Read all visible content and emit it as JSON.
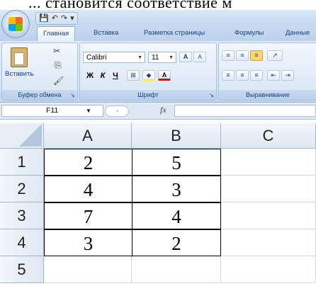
{
  "top_text": "... становится соответствие м",
  "quick_access": {
    "save_icon": "save-icon",
    "undo_icon": "undo-icon",
    "redo_icon": "redo-icon",
    "more": "▾"
  },
  "tabs": [
    {
      "label": "Главная",
      "active": true
    },
    {
      "label": "Вставка"
    },
    {
      "label": "Разметка страницы"
    },
    {
      "label": "Формулы"
    },
    {
      "label": "Данные"
    }
  ],
  "ribbon": {
    "clipboard": {
      "paste_label": "Вставить",
      "group_label": "Буфер обмена"
    },
    "font": {
      "font_name": "Calibri",
      "font_size": "11",
      "grow": "A",
      "shrink": "A",
      "bold": "Ж",
      "italic": "К",
      "underline": "Ч",
      "group_label": "Шрифт"
    },
    "alignment": {
      "group_label": "Выравнивание"
    }
  },
  "formula_bar": {
    "name_box": "F11",
    "fx": "fx",
    "formula": ""
  },
  "sheet": {
    "columns": [
      "A",
      "B",
      "C"
    ],
    "rows": [
      "1",
      "2",
      "3",
      "4",
      "5"
    ],
    "cells": [
      [
        "2",
        "5"
      ],
      [
        "4",
        "3"
      ],
      [
        "7",
        "4"
      ],
      [
        "3",
        "2"
      ]
    ]
  }
}
